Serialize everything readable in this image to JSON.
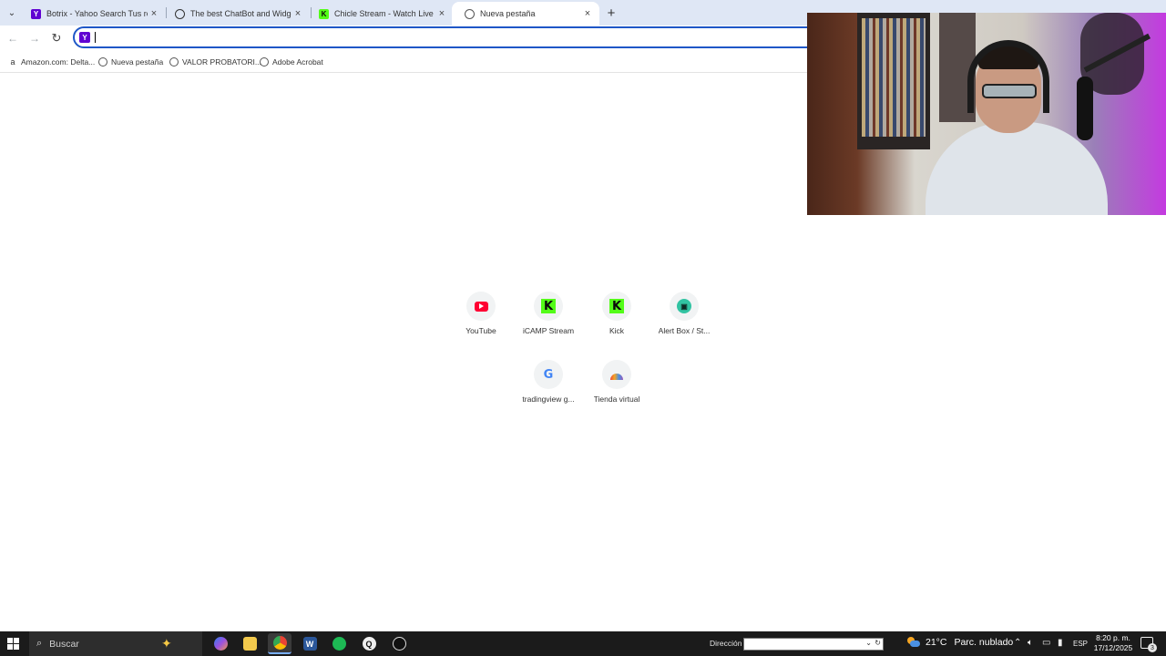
{
  "browser": {
    "tabs": [
      {
        "title": "Botrix - Yahoo Search Tus resulta",
        "favicon": "yahoo-icon",
        "active": false
      },
      {
        "title": "The best ChatBot and Widgets",
        "favicon": "botrix-icon",
        "active": false
      },
      {
        "title": "Chicle Stream - Watch Live on K",
        "favicon": "kick-icon",
        "active": false
      },
      {
        "title": "Nueva pestaña",
        "favicon": "globe-icon",
        "active": true
      }
    ],
    "tab_search_icon": "chevron-down-icon",
    "new_tab_icon": "plus-icon",
    "toolbar": {
      "back_icon": "arrow-left-icon",
      "forward_icon": "arrow-right-icon",
      "reload_icon": "reload-icon",
      "omnibox_value": "",
      "search_engine_icon": "yahoo-icon"
    },
    "bookmarks": [
      {
        "label": "Amazon.com: Delta...",
        "icon": "amazon-icon"
      },
      {
        "label": "Nueva pestaña",
        "icon": "globe-icon"
      },
      {
        "label": "VALOR PROBATORI...",
        "icon": "globe-icon"
      },
      {
        "label": "Adobe Acrobat",
        "icon": "globe-icon"
      }
    ]
  },
  "newtab": {
    "shortcuts": [
      {
        "label": "YouTube",
        "icon": "youtube-icon"
      },
      {
        "label": "iCAMP Stream",
        "icon": "kick-icon"
      },
      {
        "label": "Kick",
        "icon": "kick-icon"
      },
      {
        "label": "Alert Box / St...",
        "icon": "streamlabs-icon"
      },
      {
        "label": "tradingview g...",
        "icon": "google-icon"
      },
      {
        "label": "Tienda virtual",
        "icon": "rainbow-icon"
      }
    ]
  },
  "taskbar": {
    "search_placeholder": "Buscar",
    "address_label": "Dirección",
    "weather_temp": "21°C",
    "weather_condition": "Parc. nublado",
    "language": "ESP",
    "time": "8:20 p. m.",
    "date": "17/12/2025",
    "notification_count": "3",
    "apps": [
      "copilot-icon",
      "file-explorer-icon",
      "chrome-icon",
      "word-icon",
      "spotify-icon",
      "obs-icon",
      "obs-studio-icon"
    ]
  },
  "colors": {
    "accent": "#1f57c7",
    "tabstrip": "#dfe7f5",
    "taskbar": "#1b1b1b",
    "kick_green": "#53fc18",
    "youtube_red": "#ff0033",
    "yahoo_purple": "#6001d2"
  }
}
